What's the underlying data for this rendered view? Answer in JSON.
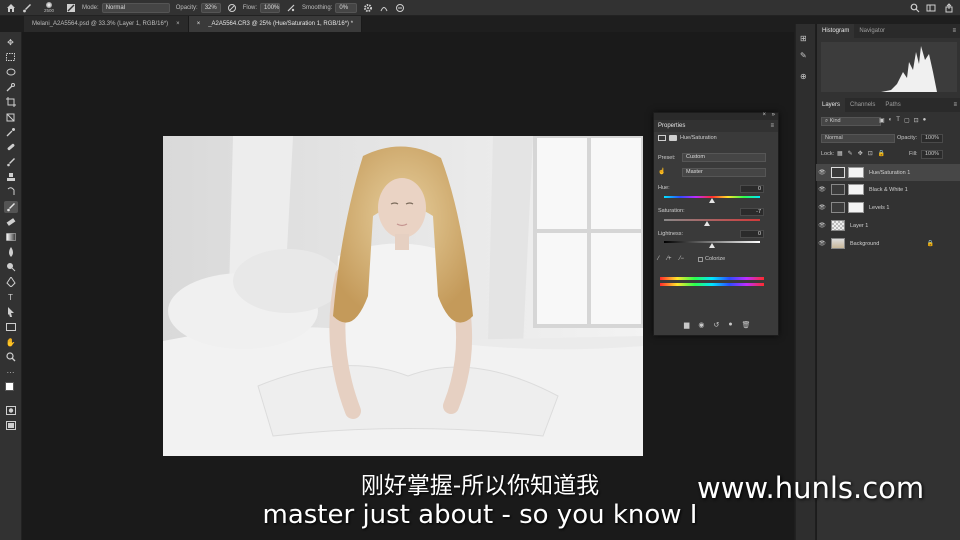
{
  "options_bar": {
    "brush_size": "2500",
    "mode_label": "Mode:",
    "mode_value": "Normal",
    "opacity_label": "Opacity:",
    "opacity_value": "32%",
    "flow_label": "Flow:",
    "flow_value": "100%",
    "smoothing_label": "Smoothing:",
    "smoothing_value": "0%"
  },
  "tabs": [
    {
      "label": "Melani_A2A5564.psd @ 33.3% (Layer 1, RGB/16*)",
      "close": "×"
    },
    {
      "label": "_A2A5564.CR3 @ 25% (Hue/Saturation 1, RGB/16*) *",
      "close": "×"
    }
  ],
  "properties": {
    "title": "Properties",
    "adjustment_name": "Hue/Saturation",
    "preset_label": "Preset:",
    "preset_value": "Custom",
    "channel_value": "Master",
    "hue_label": "Hue:",
    "hue_value": "0",
    "saturation_label": "Saturation:",
    "saturation_value": "-7",
    "lightness_label": "Lightness:",
    "lightness_value": "0",
    "colorize_label": "Colorize"
  },
  "histogram_tabs": [
    "Histogram",
    "Navigator"
  ],
  "layers_panel": {
    "tabs": [
      "Layers",
      "Channels",
      "Paths"
    ],
    "filter_value": "Kind",
    "blend_mode": "Normal",
    "opacity_label": "Opacity:",
    "opacity_value": "100%",
    "lock_label": "Lock:",
    "fill_label": "Fill:",
    "fill_value": "100%",
    "layers": [
      {
        "name": "Hue/Saturation 1",
        "selected": true
      },
      {
        "name": "Black & White 1",
        "selected": false
      },
      {
        "name": "Levels 1",
        "selected": false
      },
      {
        "name": "Layer 1",
        "selected": false
      },
      {
        "name": "Background",
        "selected": false
      }
    ]
  },
  "subtitles": {
    "chinese": "刚好掌握-所以你知道我",
    "english": "master just about - so you know I"
  },
  "watermark": "www.hunls.com",
  "colors": {
    "accent": "#2d8cf0",
    "panel_bg": "#323232",
    "canvas_bg": "#1a1a1a"
  }
}
